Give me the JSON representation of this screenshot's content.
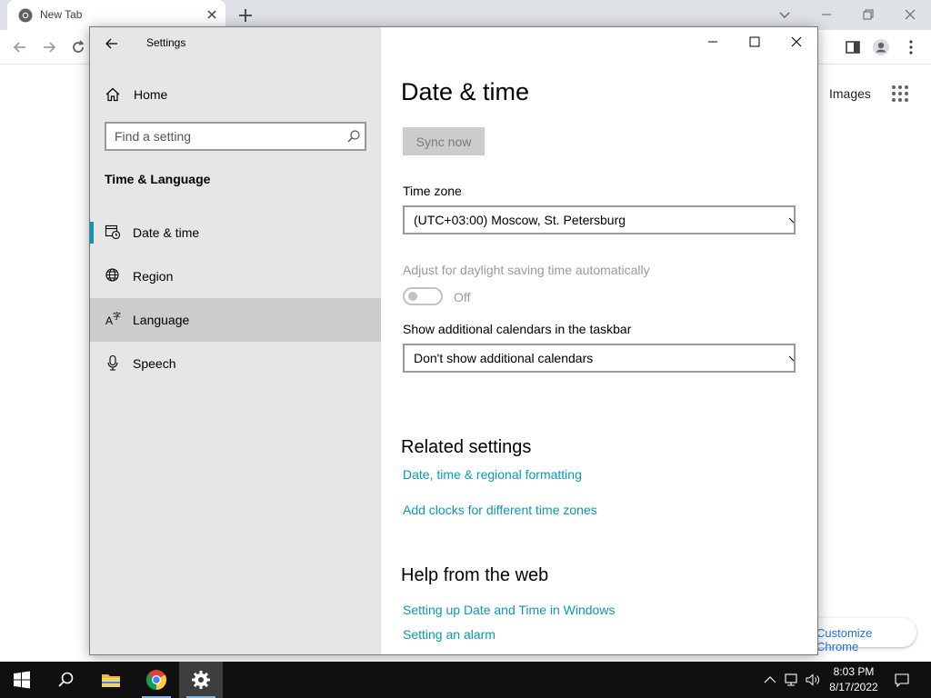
{
  "browser": {
    "tab_title": "New Tab",
    "images_link": "Images",
    "customize_button": "Customize Chrome"
  },
  "window": {
    "title": "Settings"
  },
  "nav": {
    "home_label": "Home",
    "search_placeholder": "Find a setting",
    "section_heading": "Time & Language",
    "items": [
      {
        "label": "Date & time",
        "icon": "date-time-icon",
        "state": "selected"
      },
      {
        "label": "Region",
        "icon": "globe-icon",
        "state": "normal"
      },
      {
        "label": "Language",
        "icon": "language-icon",
        "state": "hover"
      },
      {
        "label": "Speech",
        "icon": "microphone-icon",
        "state": "normal"
      }
    ]
  },
  "content": {
    "page_title": "Date & time",
    "sync_button": "Sync now",
    "time_zone": {
      "label": "Time zone",
      "value": "(UTC+03:00) Moscow, St. Petersburg"
    },
    "dst": {
      "label": "Adjust for daylight saving time automatically",
      "state_label": "Off",
      "on": false
    },
    "calendars": {
      "label": "Show additional calendars in the taskbar",
      "value": "Don't show additional calendars"
    },
    "related": {
      "title": "Related settings",
      "links": [
        "Date, time & regional formatting",
        "Add clocks for different time zones"
      ]
    },
    "help": {
      "title": "Help from the web",
      "links": [
        "Setting up Date and Time in Windows",
        "Setting an alarm"
      ]
    }
  },
  "taskbar": {
    "time": "8:03 PM",
    "date": "8/17/2022",
    "pinned": [
      "windows-start-icon",
      "search-icon",
      "file-explorer-icon",
      "chrome-icon",
      "settings-gear-icon"
    ]
  },
  "colors": {
    "accent": "#0b97b5",
    "nav_background": "#e6e6e6",
    "taskbar": "#101010"
  }
}
